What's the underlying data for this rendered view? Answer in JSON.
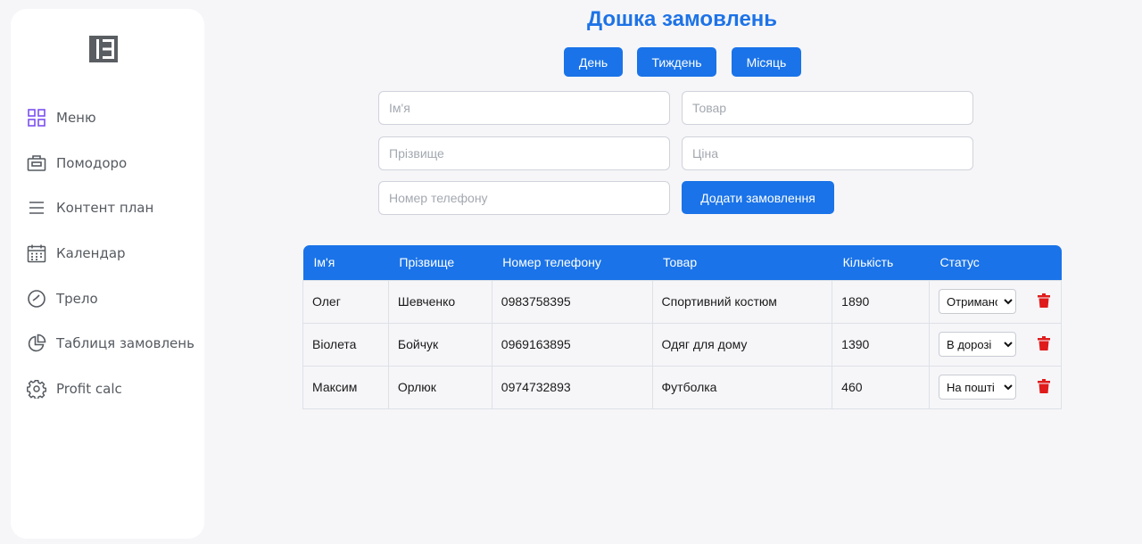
{
  "sidebar": {
    "items": [
      {
        "label": "Меню",
        "icon": "grid-icon"
      },
      {
        "label": "Помодоро",
        "icon": "briefcase-icon"
      },
      {
        "label": "Контент план",
        "icon": "menu-lines-icon"
      },
      {
        "label": "Календар",
        "icon": "calendar-icon"
      },
      {
        "label": "Трело",
        "icon": "clock-icon"
      },
      {
        "label": "Таблиця замовлень",
        "icon": "pie-chart-icon"
      },
      {
        "label": "Profit calc",
        "icon": "gear-icon"
      }
    ],
    "active_index": 0,
    "active_color": "#7b4ff0"
  },
  "page": {
    "title": "Дошка замовлень",
    "accent_color": "#1a73e8"
  },
  "periods": [
    "День",
    "Тиждень",
    "Місяць"
  ],
  "form": {
    "first_name_placeholder": "Ім'я",
    "last_name_placeholder": "Прізвище",
    "phone_placeholder": "Номер телефону",
    "product_placeholder": "Товар",
    "price_placeholder": "Ціна",
    "submit_label": "Додати замовлення"
  },
  "table": {
    "headers": [
      "Ім'я",
      "Прізвище",
      "Номер телефону",
      "Товар",
      "Кількість",
      "Статус"
    ],
    "rows": [
      {
        "first_name": "Олег",
        "last_name": "Шевченко",
        "phone": "0983758395",
        "product": "Спортивний костюм",
        "quantity": "1890",
        "status": "Отримано"
      },
      {
        "first_name": "Віолета",
        "last_name": "Бойчук",
        "phone": "0969163895",
        "product": "Одяг для дому",
        "quantity": "1390",
        "status": "В дорозі"
      },
      {
        "first_name": "Максим",
        "last_name": "Орлюк",
        "phone": "0974732893",
        "product": "Футболка",
        "quantity": "460",
        "status": "На пошті"
      }
    ],
    "delete_color": "#e01b1b"
  }
}
